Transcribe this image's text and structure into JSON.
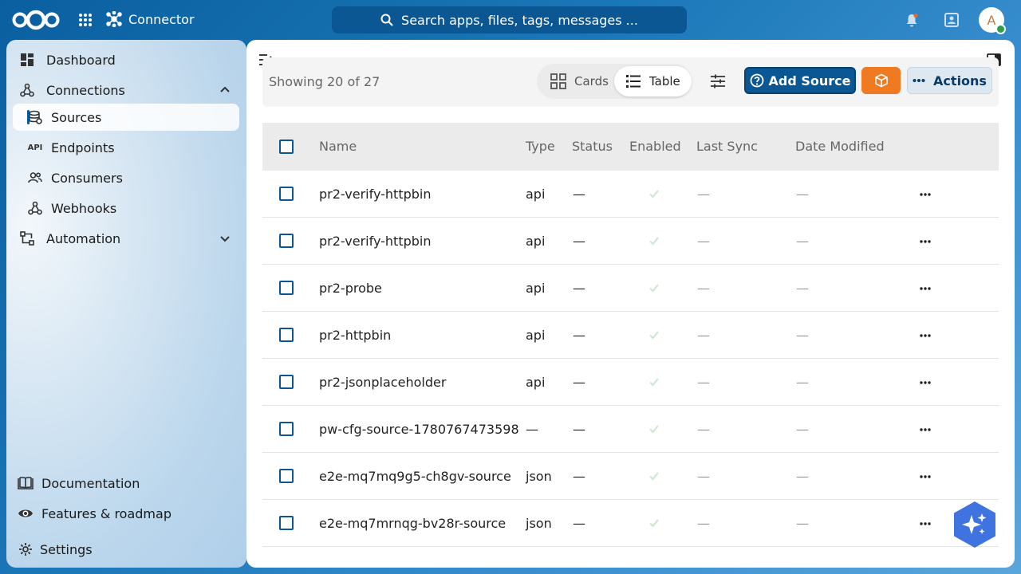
{
  "header": {
    "app_name": "Connector",
    "search_placeholder": "Search apps, files, tags, messages ...",
    "avatar_initial": "A"
  },
  "sidebar": {
    "items": [
      {
        "label": "Dashboard",
        "icon": "dashboard-icon"
      },
      {
        "label": "Connections",
        "icon": "connections-icon",
        "expanded": true
      },
      {
        "label": "Sources",
        "icon": "sources-icon",
        "active": true
      },
      {
        "label": "Endpoints",
        "icon": "api-icon",
        "icon_text": "API"
      },
      {
        "label": "Consumers",
        "icon": "consumers-icon"
      },
      {
        "label": "Webhooks",
        "icon": "webhooks-icon"
      },
      {
        "label": "Automation",
        "icon": "automation-icon",
        "expanded": false
      }
    ],
    "footer": [
      {
        "label": "Documentation",
        "icon": "book-icon"
      },
      {
        "label": "Features & roadmap",
        "icon": "eye-icon"
      },
      {
        "label": "Settings",
        "icon": "gear-icon"
      }
    ]
  },
  "toolbar": {
    "showing": "Showing 20 of 27",
    "cards_label": "Cards",
    "table_label": "Table",
    "add_label": "Add Source",
    "actions_label": "Actions"
  },
  "table": {
    "columns": [
      "Name",
      "Type",
      "Status",
      "Enabled",
      "Last Sync",
      "Date Modified"
    ],
    "rows": [
      {
        "name": "pr2-verify-httpbin",
        "type": "api",
        "status": "—",
        "last_sync": "—",
        "date_modified": "—"
      },
      {
        "name": "pr2-verify-httpbin",
        "type": "api",
        "status": "—",
        "last_sync": "—",
        "date_modified": "—"
      },
      {
        "name": "pr2-probe",
        "type": "api",
        "status": "—",
        "last_sync": "—",
        "date_modified": "—"
      },
      {
        "name": "pr2-httpbin",
        "type": "api",
        "status": "—",
        "last_sync": "—",
        "date_modified": "—"
      },
      {
        "name": "pr2-jsonplaceholder",
        "type": "api",
        "status": "—",
        "last_sync": "—",
        "date_modified": "—"
      },
      {
        "name": "pw-cfg-source-1780767473598",
        "type": "—",
        "status": "—",
        "last_sync": "—",
        "date_modified": "—"
      },
      {
        "name": "e2e-mq7mq9g5-ch8gv-source",
        "type": "json",
        "status": "—",
        "last_sync": "—",
        "date_modified": "—"
      },
      {
        "name": "e2e-mq7mrnqg-bv28r-source",
        "type": "json",
        "status": "—",
        "last_sync": "—",
        "date_modified": "—"
      }
    ]
  },
  "colors": {
    "primary": "#0b5794",
    "accent_orange": "#f07a22",
    "enabled_check": "#cfe8d4"
  }
}
